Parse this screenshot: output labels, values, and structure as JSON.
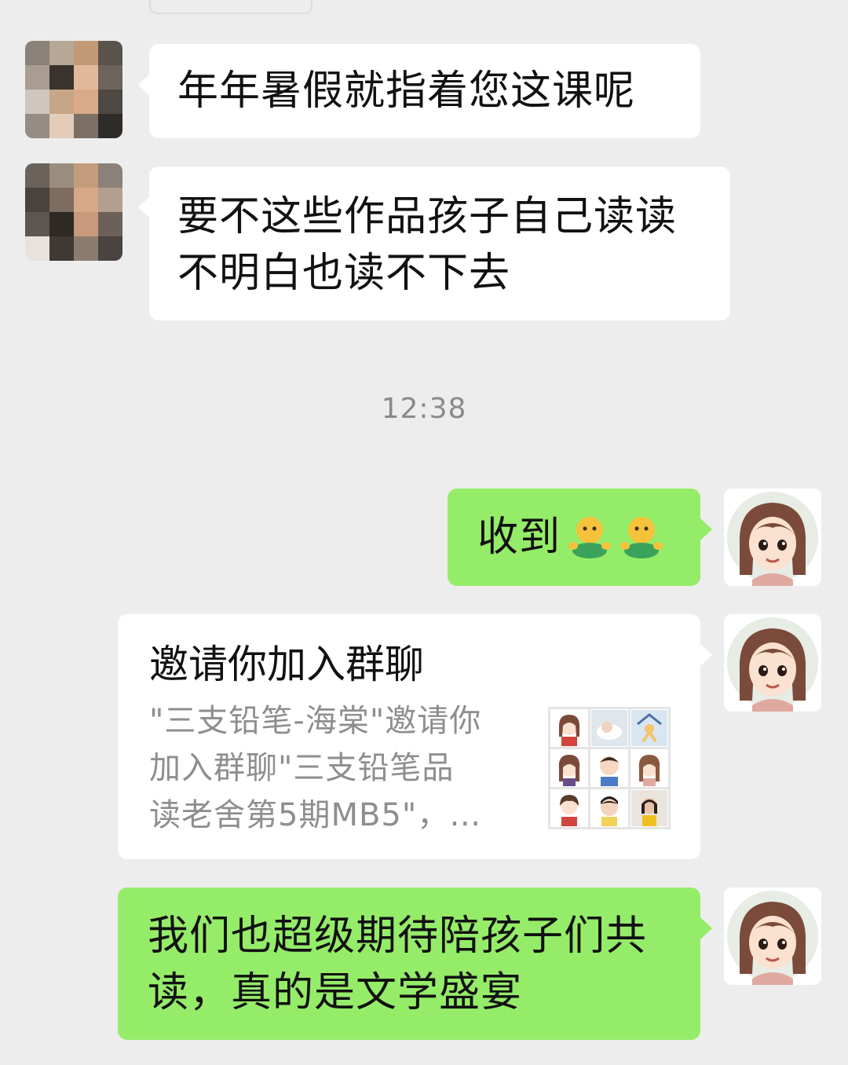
{
  "timestamp": "12:38",
  "messages": [
    {
      "side": "left",
      "text": "年年暑假就指着您这课呢"
    },
    {
      "side": "left",
      "lines": [
        "要不这些作品孩子自己读读",
        "不明白也读不下去"
      ]
    },
    {
      "side": "right",
      "text": "收到",
      "emojis": [
        "hug-emoji",
        "hug-emoji"
      ]
    },
    {
      "side": "right",
      "type": "group-invite",
      "title": "邀请你加入群聊",
      "desc_lines": [
        "\"三支铅笔-海棠\"邀请你",
        "加入群聊\"三支铅笔品",
        "读老舍第5期MB5\"，…"
      ]
    },
    {
      "side": "right",
      "lines": [
        "我们也超级期待陪孩子们共",
        "读，真的是文学盛宴"
      ]
    }
  ],
  "colors": {
    "background": "#ededed",
    "bubble_self": "#95ec69",
    "bubble_other": "#ffffff",
    "timestamp": "#8a8a8a"
  }
}
